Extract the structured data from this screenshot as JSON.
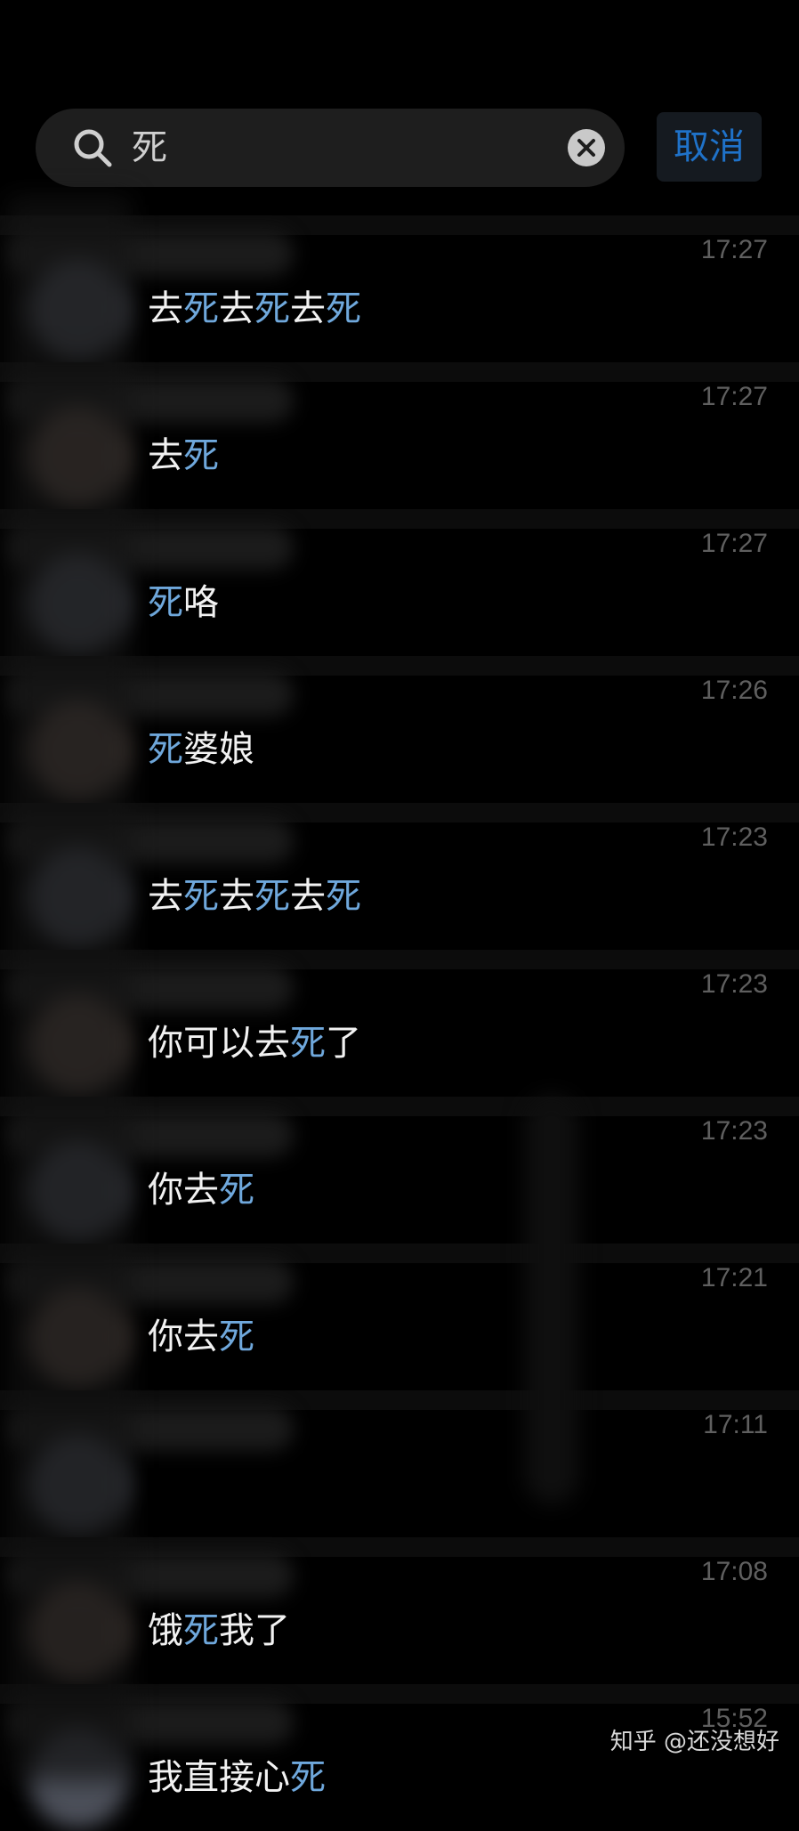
{
  "search": {
    "query": "死",
    "cancel_label": "取消"
  },
  "colors": {
    "background": "#000000",
    "highlight": "#6fa8dc",
    "accent": "#1f72c9",
    "time": "#5f5f5f"
  },
  "results": [
    {
      "time": "17:27",
      "parts": [
        [
          "去",
          0
        ],
        [
          "死",
          1
        ],
        [
          "去",
          0
        ],
        [
          "死",
          1
        ],
        [
          "去",
          0
        ],
        [
          "死",
          1
        ]
      ],
      "avatar": "#5a5e6a"
    },
    {
      "time": "17:27",
      "parts": [
        [
          "去",
          0
        ],
        [
          "死",
          1
        ]
      ],
      "avatar": "#6a5a52"
    },
    {
      "time": "17:27",
      "parts": [
        [
          "死",
          1
        ],
        [
          "咯",
          0
        ]
      ],
      "avatar": "#5a5e6a"
    },
    {
      "time": "17:26",
      "parts": [
        [
          "死",
          1
        ],
        [
          "婆娘",
          0
        ]
      ],
      "avatar": "#6a5a52"
    },
    {
      "time": "17:23",
      "parts": [
        [
          "去",
          0
        ],
        [
          "死",
          1
        ],
        [
          "去",
          0
        ],
        [
          "死",
          1
        ],
        [
          "去",
          0
        ],
        [
          "死",
          1
        ]
      ],
      "avatar": "#5a5e6a"
    },
    {
      "time": "17:23",
      "parts": [
        [
          "你可以去",
          0
        ],
        [
          "死",
          1
        ],
        [
          "了",
          0
        ]
      ],
      "avatar": "#6a5a52"
    },
    {
      "time": "17:23",
      "parts": [
        [
          "你去",
          0
        ],
        [
          "死",
          1
        ]
      ],
      "avatar": "#5a5e6a"
    },
    {
      "time": "17:21",
      "parts": [
        [
          "你去",
          0
        ],
        [
          "死",
          1
        ]
      ],
      "avatar": "#6a5a52"
    },
    {
      "time": "17:11",
      "parts": [],
      "avatar": "#5a5e6a"
    },
    {
      "time": "17:08",
      "parts": [
        [
          "饿",
          0
        ],
        [
          "死",
          1
        ],
        [
          "我了",
          0
        ]
      ],
      "avatar": "#6a5a52"
    },
    {
      "time": "15:52",
      "parts": [
        [
          "我直接心",
          0
        ],
        [
          "死",
          1
        ]
      ],
      "avatar": "#5a5e6a"
    }
  ],
  "watermark": "知乎 @还没想好"
}
